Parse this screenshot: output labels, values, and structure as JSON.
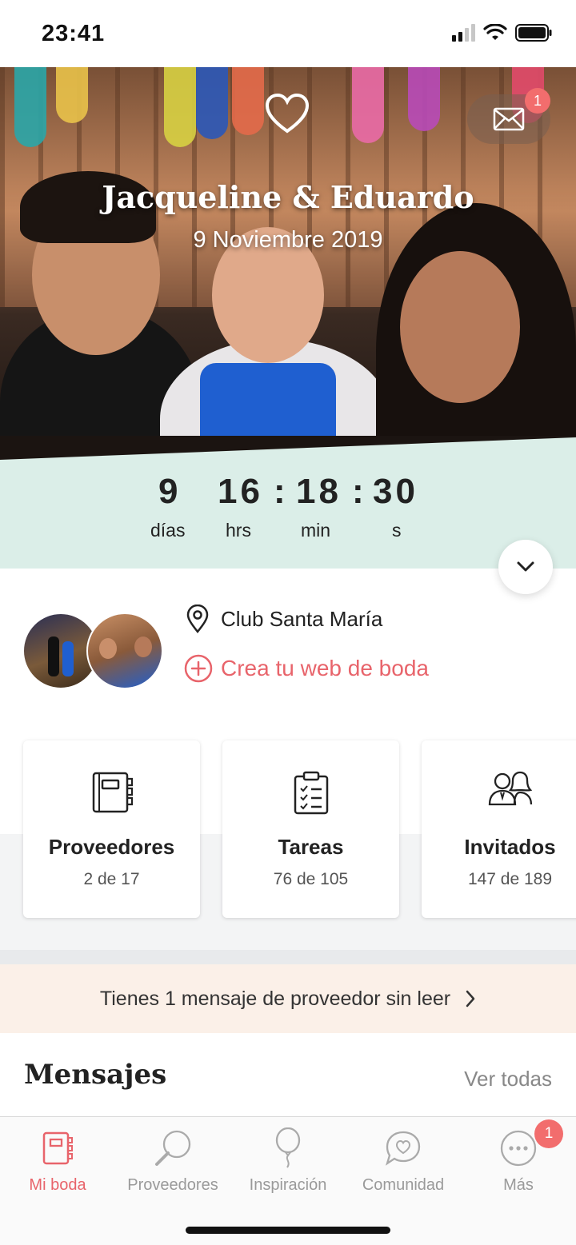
{
  "status_bar": {
    "time": "23:41"
  },
  "hero": {
    "names": "Jacqueline & Eduardo",
    "date": "9 Noviembre 2019",
    "mail_badge": "1"
  },
  "countdown": {
    "days": "9",
    "hours": "16",
    "minutes": "18",
    "seconds": "30",
    "separator": ":",
    "units": {
      "days": "días",
      "hours": "hrs",
      "minutes": "min",
      "seconds": "s"
    }
  },
  "info": {
    "venue": "Club Santa María",
    "web_link": "Crea tu web de boda"
  },
  "cards": [
    {
      "title": "Proveedores",
      "count": "2 de 17",
      "icon": "notebook-icon"
    },
    {
      "title": "Tareas",
      "count": "76 de 105",
      "icon": "checklist-icon"
    },
    {
      "title": "Invitados",
      "count": "147 de 189",
      "icon": "guests-icon"
    }
  ],
  "notice": {
    "text": "Tienes 1 mensaje de proveedor sin leer"
  },
  "messages": {
    "title": "Mensajes",
    "see_all": "Ver todas"
  },
  "tabbar": {
    "items": [
      {
        "label": "Mi boda",
        "icon": "wedding-book-icon",
        "active": true
      },
      {
        "label": "Proveedores",
        "icon": "magnifier-icon",
        "active": false
      },
      {
        "label": "Inspiración",
        "icon": "balloon-icon",
        "active": false
      },
      {
        "label": "Comunidad",
        "icon": "chat-heart-icon",
        "active": false
      },
      {
        "label": "Más",
        "icon": "more-icon",
        "active": false
      }
    ],
    "more_badge": "1"
  },
  "colors": {
    "accent": "#e8646b",
    "countdown_bg": "#dbeee8",
    "notice_bg": "#fbf0e8"
  }
}
